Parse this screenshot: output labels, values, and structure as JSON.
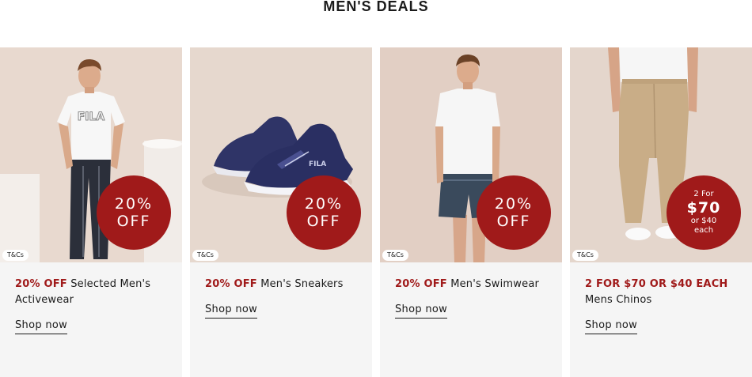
{
  "section": {
    "title": "MEN'S DEALS"
  },
  "colors": {
    "accent": "#a01a1a",
    "card_bg": "#f5f5f5"
  },
  "cards": [
    {
      "badge_line1": "20%",
      "badge_line2": "OFF",
      "tcs_label": "T&Cs",
      "deal_text": "20% OFF",
      "description": " Selected Men's Activewear",
      "cta_label": "Shop now",
      "image_subject": "man-in-fila-tee-and-track-pants"
    },
    {
      "badge_line1": "20%",
      "badge_line2": "OFF",
      "tcs_label": "T&Cs",
      "deal_text": "20% OFF",
      "description": " Men's Sneakers",
      "cta_label": "Shop now",
      "image_subject": "navy-fila-sneakers"
    },
    {
      "badge_line1": "20%",
      "badge_line2": "OFF",
      "tcs_label": "T&Cs",
      "deal_text": "20% OFF",
      "description": " Men's Swimwear",
      "cta_label": "Shop now",
      "image_subject": "man-in-white-tee-and-swim-shorts"
    },
    {
      "badge_line1": "2 For",
      "badge_line2": "$70",
      "badge_line3": "or $40",
      "badge_line4": "each",
      "tcs_label": "T&Cs",
      "deal_text": "2 FOR $70 OR $40 EACH",
      "description": "Mens Chinos",
      "cta_label": "Shop now",
      "image_subject": "man-in-tan-chinos"
    }
  ]
}
